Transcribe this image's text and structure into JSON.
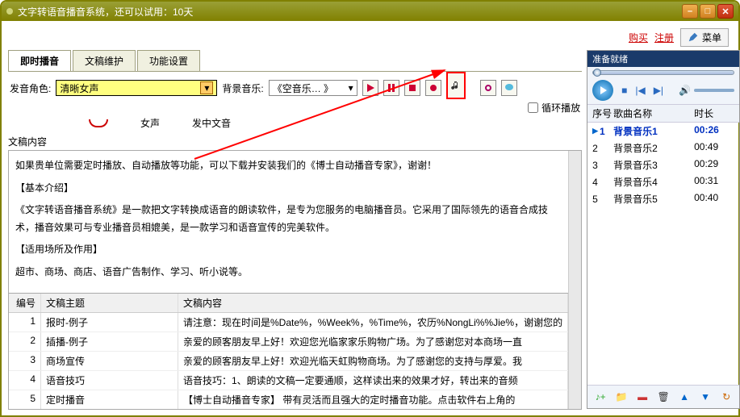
{
  "window": {
    "title": "文字转语音播音系统，还可以试用：10天"
  },
  "topbar": {
    "buy": "购买",
    "register": "注册",
    "menu": "菜单"
  },
  "tabs": {
    "t1": "即时播音",
    "t2": "文稿维护",
    "t3": "功能设置"
  },
  "toolbar": {
    "voice_label": "发音角色:",
    "voice_value": "清晰女声",
    "bgm_label": "背景音乐:",
    "bgm_value": "《空音乐… 》",
    "loop_label": "循环播放",
    "under1": "女声",
    "under2": "发中文音"
  },
  "editor": {
    "label": "文稿内容",
    "p1": "如果贵单位需要定时播放、自动播放等功能，可以下载并安装我们的《博士自动播音专家》，谢谢！",
    "h1": "【基本介绍】",
    "p2": "《文字转语音播音系统》是一款把文字转换成语音的朗读软件，是专为您服务的电脑播音员。它采用了国际领先的语音合成技术，播音效果可与专业播音员相媲美，是一款学习和语音宣传的完美软件。",
    "h2": "【适用场所及作用】",
    "p3": "超市、商场、商店、语音广告制作、学习、听小说等。"
  },
  "table": {
    "h_num": "编号",
    "h_title": "文稿主题",
    "h_content": "文稿内容",
    "rows": [
      {
        "n": "1",
        "t": "报时-例子",
        "c": "请注意：现在时间是%Date%，%Week%，%Time%，农历%NongLi%%Jie%，谢谢您的"
      },
      {
        "n": "2",
        "t": "插播-例子",
        "c": "亲爱的顾客朋友早上好！欢迎您光临家家乐购物广场。为了感谢您对本商场一直"
      },
      {
        "n": "3",
        "t": "商场宣传",
        "c": "亲爱的顾客朋友早上好！欢迎光临天虹购物商场。为了感谢您的支持与厚爱。我"
      },
      {
        "n": "4",
        "t": "语音技巧",
        "c": "语音技巧：1、朗读的文稿一定要通顺，这样读出来的效果才好，转出来的音频"
      },
      {
        "n": "5",
        "t": "定时播音",
        "c": "【博士自动播音专家】  带有灵活而且强大的定时播音功能。点击软件右上角的"
      }
    ]
  },
  "player": {
    "ready": "准备就绪",
    "h_num": "序号",
    "h_name": "歌曲名称",
    "h_dur": "时长",
    "rows": [
      {
        "n": "1",
        "name": "背景音乐1",
        "dur": "00:26",
        "sel": true
      },
      {
        "n": "2",
        "name": "背景音乐2",
        "dur": "00:49"
      },
      {
        "n": "3",
        "name": "背景音乐3",
        "dur": "00:29"
      },
      {
        "n": "4",
        "name": "背景音乐4",
        "dur": "00:31"
      },
      {
        "n": "5",
        "name": "背景音乐5",
        "dur": "00:40"
      }
    ]
  }
}
